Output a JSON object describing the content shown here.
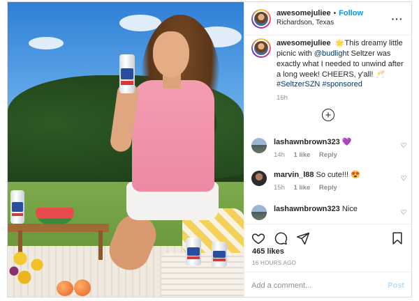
{
  "post": {
    "author": {
      "username": "awesomejuliee",
      "follow_label": "Follow",
      "location": "Richardson, Texas",
      "more_icon": "more-options-icon"
    },
    "caption": {
      "username": "awesomejuliee",
      "emoji_sparkle": "🌟",
      "text_before_mention": "This dreamy little picnic with ",
      "mention": "@budlight",
      "text_after_mention": " Seltzer was exactly what I needed to unwind after a long week! CHEERS, y'all! ",
      "emoji_cheers": "🥂",
      "hashtags": [
        "#SeltzerSZN",
        "#sponsored"
      ],
      "time": "16h"
    },
    "load_more_icon": "plus-circle-icon",
    "comments": [
      {
        "username": "lashawnbrown323",
        "text": "💜",
        "time": "14h",
        "likes": "1 like",
        "reply_label": "Reply"
      },
      {
        "username": "marvin_l88",
        "text": "So cute!!! 😍",
        "time": "15h",
        "likes": "1 like",
        "reply_label": "Reply"
      },
      {
        "username": "lashawnbrown323",
        "text": "Nice",
        "time": "",
        "likes": "",
        "reply_label": ""
      }
    ],
    "likes_count": "465 likes",
    "posted_ago": "16 HOURS AGO",
    "add_comment_placeholder": "Add a comment...",
    "post_label": "Post"
  },
  "colors": {
    "follow_blue": "#0095f6",
    "post_disabled_blue": "#b2dffc",
    "link_blue": "#00376b",
    "muted_gray": "#8e8e8e"
  }
}
